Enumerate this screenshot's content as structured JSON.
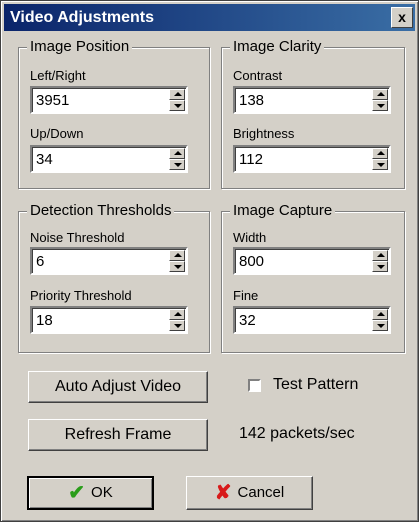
{
  "window": {
    "title": "Video Adjustments",
    "close_glyph": "x"
  },
  "groups": {
    "image_position": {
      "title": "Image Position",
      "left_right": {
        "label": "Left/Right",
        "value": "3951"
      },
      "up_down": {
        "label": "Up/Down",
        "value": "34"
      }
    },
    "image_clarity": {
      "title": "Image Clarity",
      "contrast": {
        "label": "Contrast",
        "value": "138"
      },
      "brightness": {
        "label": "Brightness",
        "value": "112"
      }
    },
    "detection_thresholds": {
      "title": "Detection Thresholds",
      "noise": {
        "label": "Noise Threshold",
        "value": "6"
      },
      "priority": {
        "label": "Priority Threshold",
        "value": "18"
      }
    },
    "image_capture": {
      "title": "Image Capture",
      "width": {
        "label": "Width",
        "value": "800"
      },
      "fine": {
        "label": "Fine",
        "value": "32"
      }
    }
  },
  "actions": {
    "auto_adjust_label": "Auto Adjust Video",
    "refresh_label": "Refresh Frame",
    "test_pattern_label": "Test Pattern",
    "test_pattern_checked": false,
    "packets_status": "142 packets/sec"
  },
  "footer": {
    "ok_label": "OK",
    "cancel_label": "Cancel"
  },
  "icons": {
    "ok": "checkmark-icon",
    "cancel": "x-icon"
  },
  "colors": {
    "title_bar": "#0a246a",
    "face": "#d4d0c8",
    "ok_icon": "#2a9d1a",
    "cancel_icon": "#d81a1a"
  }
}
